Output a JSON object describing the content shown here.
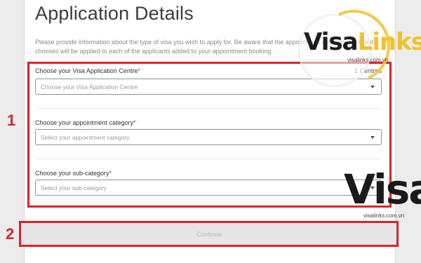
{
  "page": {
    "title": "Application Details",
    "description": "Please provide information about the type of visa you wish to apply for. Be aware that the appointment category Applicant 1 chooses will be applied to each of the applicants added to your appointment booking."
  },
  "form": {
    "centre": {
      "label": "Choose your Visa Application Centre",
      "required_mark": "*",
      "placeholder": "Choose your Visa Application Centre",
      "count": "2 Centres"
    },
    "category": {
      "label": "Choose your appointment category",
      "required_mark": "*",
      "placeholder": "Select your appointment category"
    },
    "subcategory": {
      "label": "Choose your sub-category",
      "required_mark": "*",
      "placeholder": "Select your sub-category"
    },
    "continue_label": "Continue"
  },
  "annotations": {
    "marker_1": "1",
    "marker_2": "2",
    "color": "#d9242b"
  },
  "watermark": {
    "brand_part1": "Visa",
    "brand_part2": "Links",
    "url": "visalinks.com.vn",
    "bottom_text": "VisaLinks",
    "colors": {
      "dark": "#1d1d1d",
      "accent": "#f2c22e"
    }
  }
}
